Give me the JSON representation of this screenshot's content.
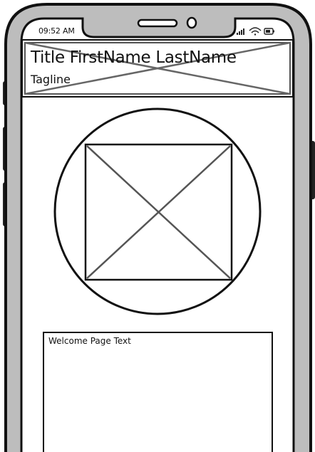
{
  "status_bar": {
    "time": "09:52 AM",
    "icons": [
      "signal-icon",
      "wifi-icon",
      "battery-icon"
    ]
  },
  "header": {
    "title": "Title FirstName LastName",
    "tagline": "Tagline",
    "background": "image-placeholder"
  },
  "hero": {
    "image": "image-placeholder"
  },
  "welcome": {
    "text": "Welcome Page Text"
  }
}
